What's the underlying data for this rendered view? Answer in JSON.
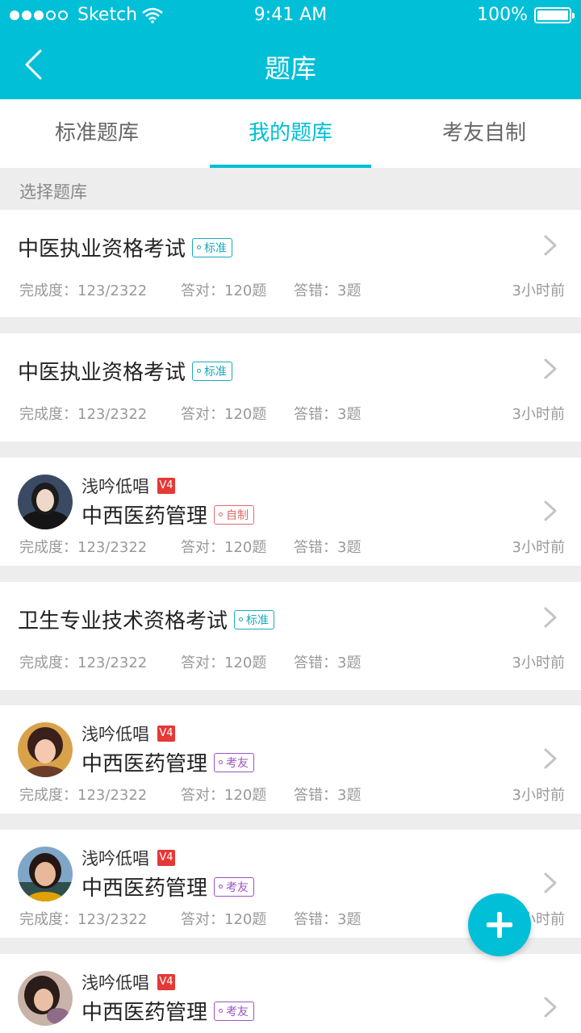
{
  "status": {
    "carrier": "Sketch",
    "time": "9:41 AM",
    "battery": "100%"
  },
  "nav": {
    "title": "题库",
    "back_icon": "chevron-left-icon"
  },
  "tabs": [
    {
      "label": "标准题库"
    },
    {
      "label": "我的题库"
    },
    {
      "label": "考友自制"
    }
  ],
  "active_tab": 1,
  "section_label": "选择题库",
  "cards": [
    {
      "title": "中医执业资格考试",
      "tag": "标准",
      "tag_type": "std",
      "progress": "完成度：123/2322",
      "correct": "答对：120题",
      "wrong": "答错：3题",
      "time": "3小时前"
    },
    {
      "title": "中医执业资格考试",
      "tag": "标准",
      "tag_type": "std",
      "progress": "完成度：123/2322",
      "correct": "答对：120题",
      "wrong": "答错：3题",
      "time": "3小时前"
    },
    {
      "author": "浅吟低唱",
      "level": "V4",
      "title": "中西医药管理",
      "tag": "自制",
      "tag_type": "self",
      "progress": "完成度：123/2322",
      "correct": "答对：120题",
      "wrong": "答错：3题",
      "time": "3小时前"
    },
    {
      "title": "卫生专业技术资格考试",
      "tag": "标准",
      "tag_type": "std",
      "progress": "完成度：123/2322",
      "correct": "答对：120题",
      "wrong": "答错：3题",
      "time": "3小时前"
    },
    {
      "author": "浅吟低唱",
      "level": "V4",
      "title": "中西医药管理",
      "tag": "考友",
      "tag_type": "friend",
      "progress": "完成度：123/2322",
      "correct": "答对：120题",
      "wrong": "答错：3题",
      "time": "3小时前"
    },
    {
      "author": "浅吟低唱",
      "level": "V4",
      "title": "中西医药管理",
      "tag": "考友",
      "tag_type": "friend",
      "progress": "完成度：123/2322",
      "correct": "答对：120题",
      "wrong": "答错：3题",
      "time": "3小时前"
    },
    {
      "author": "浅吟低唱",
      "level": "V4",
      "title": "中西医药管理",
      "tag": "考友",
      "tag_type": "friend"
    }
  ],
  "colors": {
    "accent": "#00bfd6",
    "tag_standard": "#1aaabf",
    "tag_self": "#e06b6b",
    "tag_friend": "#9b53c4",
    "level_badge": "#e53935"
  },
  "fab_icon": "plus-icon"
}
